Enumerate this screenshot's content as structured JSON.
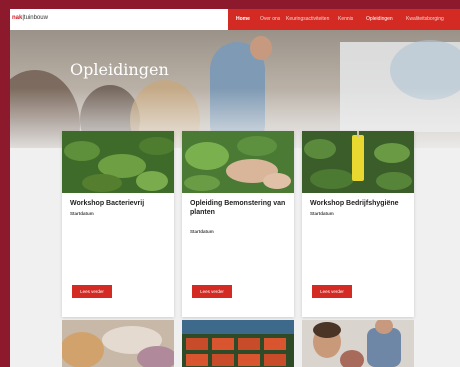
{
  "logo": {
    "prefix": "nak",
    "name": "tuinbouw"
  },
  "nav": {
    "items": [
      {
        "label": "Home",
        "active": true
      },
      {
        "label": "Over ons",
        "active": false
      },
      {
        "label": "Keuringsactiviteiten",
        "active": false
      },
      {
        "label": "Kennis",
        "active": false
      },
      {
        "label": "Opleidingen",
        "active": false
      },
      {
        "label": "Kwaliteitsborging",
        "active": false
      }
    ]
  },
  "hero": {
    "title": "Opleidingen"
  },
  "cards": [
    {
      "title": "Workshop Bacterievrij",
      "meta_label": "Startdatum",
      "image": "plant-leaves-photo",
      "button": "Lees verder"
    },
    {
      "title": "Opleiding Bemonstering van planten",
      "meta_label": "Startdatum",
      "image": "hand-on-plant-photo",
      "button": "Lees verder"
    },
    {
      "title": "Workshop Bedrijfshygiëne",
      "meta_label": "Startdatum",
      "image": "yellow-sticky-trap-photo",
      "button": "Lees verder"
    }
  ],
  "colors": {
    "brand": "#d42a24",
    "frame": "#8c1a2c"
  }
}
